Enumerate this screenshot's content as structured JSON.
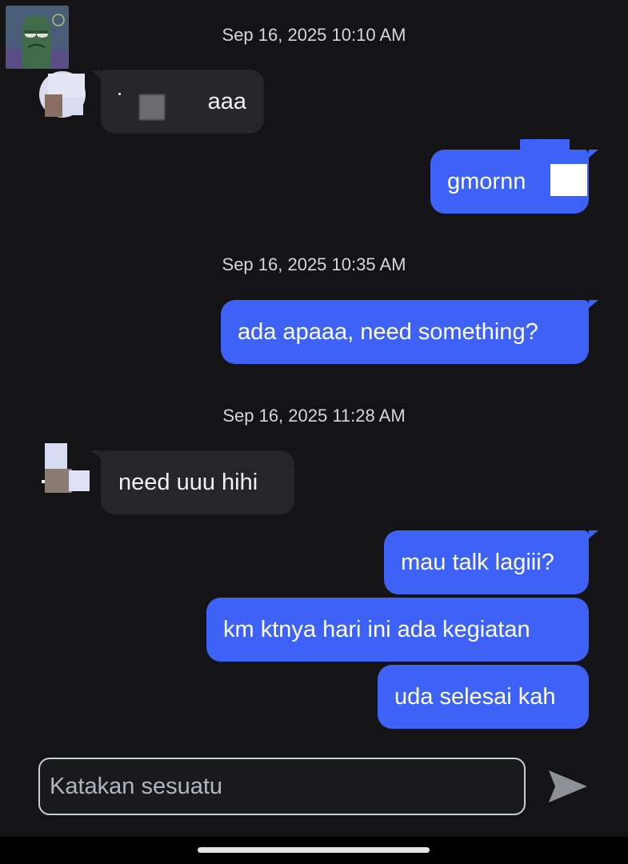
{
  "chat": {
    "timestamps": [
      "Sep 16, 2025 10:10 AM",
      "Sep 16, 2025 10:35 AM",
      "Sep 16, 2025 11:28 AM"
    ],
    "messages": [
      {
        "from": "them",
        "text": "aaa",
        "note_redacted": true
      },
      {
        "from": "me",
        "text": "gmornn"
      },
      {
        "from": "me",
        "text": "ada apaaa, need something?"
      },
      {
        "from": "them",
        "text": "need uuu hihi"
      },
      {
        "from": "me",
        "text": "mau talk lagiii?"
      },
      {
        "from": "me",
        "text": "km ktnya hari ini ada kegiatan"
      },
      {
        "from": "me",
        "text": "uda selesai kah"
      }
    ]
  },
  "composer": {
    "placeholder": "Katakan sesuatu"
  },
  "icons": {
    "send": "send-arrow-icon",
    "profile": "profile-avatar-icon"
  },
  "colors": {
    "background": "#141416",
    "incoming_bubble": "#26262a",
    "outgoing_bubble": "#3e62f6",
    "input_border": "#c8ccd8",
    "send_icon": "#8e9096"
  }
}
